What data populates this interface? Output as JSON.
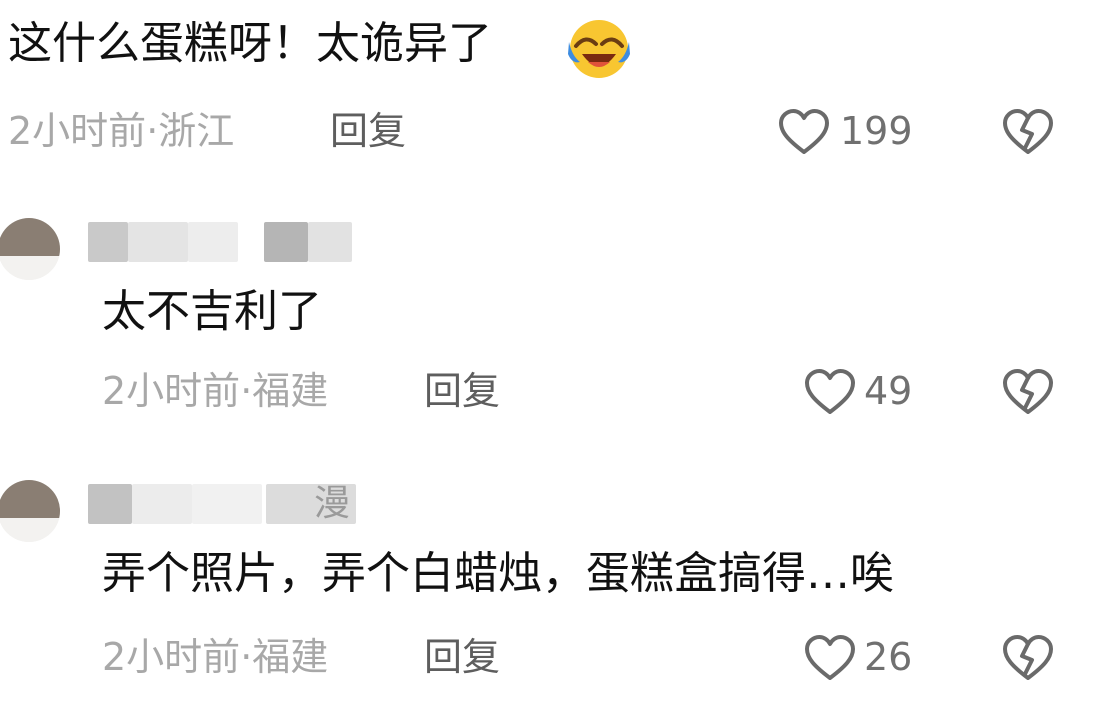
{
  "comments": [
    {
      "text_prefix": "这什么蛋糕呀！太诡异了",
      "emoji": "face-with-tears-of-joy-icon",
      "time": "2小时前",
      "location": "浙江",
      "reply_label": "回复",
      "likes": "199"
    },
    {
      "username_visible": "",
      "text": "太不吉利了",
      "time": "2小时前",
      "location": "福建",
      "reply_label": "回复",
      "likes": "49"
    },
    {
      "username_visible": "漫",
      "text": "弄个照片，弄个白蜡烛，蛋糕盒搞得…唉",
      "time": "2小时前",
      "location": "福建",
      "reply_label": "回复",
      "likes": "26"
    }
  ],
  "colors": {
    "meta": "#a8a8a8",
    "reply": "#5e5e5e",
    "icon": "#6a6a6a",
    "emoji_yellow": "#f8c631",
    "emoji_blue": "#3d8ce0"
  }
}
